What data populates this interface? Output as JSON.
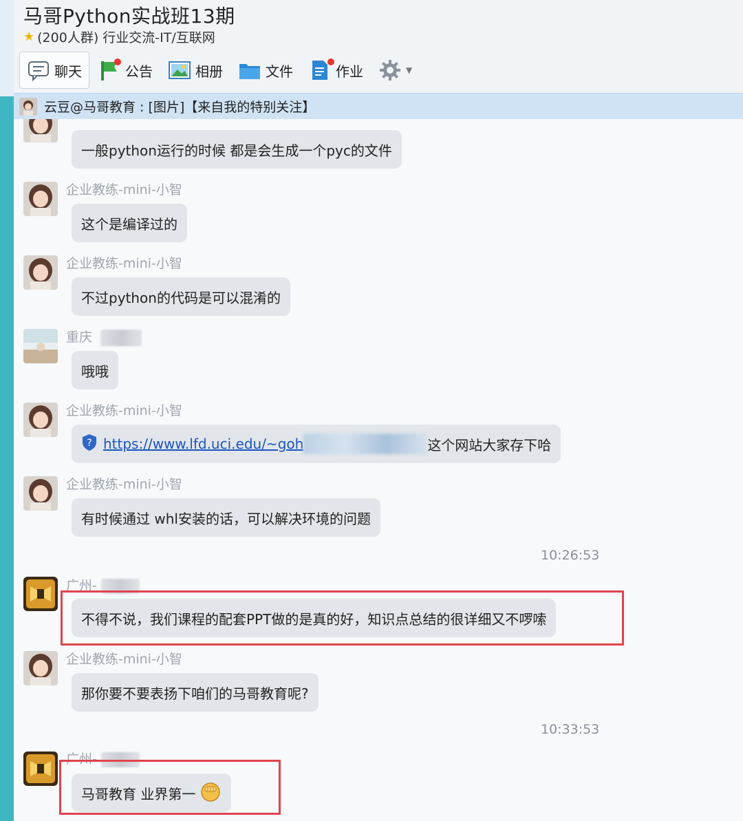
{
  "group": {
    "title": "马哥Python实战班13期",
    "subtitle": "(200人群) 行业交流-IT/互联网"
  },
  "toolbar": {
    "chat": "聊天",
    "announce": "公告",
    "album": "相册",
    "files": "文件",
    "homework": "作业"
  },
  "notice": {
    "text": "云豆@马哥教育 : [图片]【来自我的特别关注】"
  },
  "messages": [
    {
      "sender": "",
      "text": "一般python运行的时候 都是会生成一个pyc的文件"
    },
    {
      "sender": "企业教练-mini-小智",
      "text": "这个是编译过的"
    },
    {
      "sender": "企业教练-mini-小智",
      "text": "不过python的代码是可以混淆的"
    },
    {
      "sender": "重庆",
      "text": "哦哦"
    },
    {
      "sender": "企业教练-mini-小智",
      "link": "https://www.lfd.uci.edu/~goh",
      "text": "这个网站大家存下哈"
    },
    {
      "sender": "企业教练-mini-小智",
      "text": "有时候通过 whl安装的话，可以解决环境的问题"
    },
    {
      "sender": "广州-",
      "text": "不得不说，我们课程的配套PPT做的是真的好，知识点总结的很详细又不啰嗦"
    },
    {
      "sender": "企业教练-mini-小智",
      "text": "那你要不要表扬下咱们的马哥教育呢?"
    },
    {
      "sender": "广州-",
      "text": "马哥教育 业界第一"
    }
  ],
  "times": [
    "10:26:53",
    "10:33:53"
  ],
  "icons": {
    "star": "star-icon",
    "chat": "chat-bubble-icon",
    "announce": "flag-icon",
    "album": "picture-icon",
    "files": "folder-icon",
    "homework": "document-icon",
    "settings": "gear-icon",
    "link_shield": "shield-icon",
    "emoji": "fist-emoji-icon"
  }
}
